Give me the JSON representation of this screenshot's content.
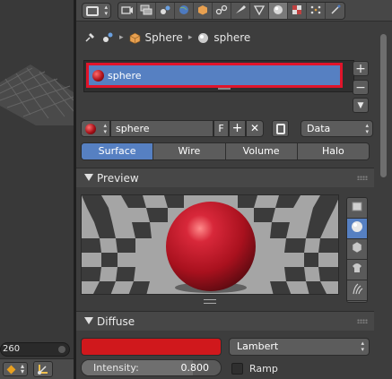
{
  "viewport": {
    "field_value": "260",
    "icons": {
      "keyframe": "keyframe-diamond-icon",
      "tool": "manipulator-icon"
    }
  },
  "header": {
    "editor_type_icon": "properties-editor-icon",
    "context_tabs": [
      {
        "name": "render-icon",
        "active": false
      },
      {
        "name": "render-layers-icon",
        "active": false
      },
      {
        "name": "scene-icon",
        "active": false
      },
      {
        "name": "world-icon",
        "active": false
      },
      {
        "name": "object-icon",
        "active": false
      },
      {
        "name": "constraints-icon",
        "active": false
      },
      {
        "name": "modifiers-icon",
        "active": false
      },
      {
        "name": "mesh-data-icon",
        "active": false
      },
      {
        "name": "material-icon",
        "active": true
      },
      {
        "name": "texture-icon",
        "active": false
      },
      {
        "name": "particles-icon",
        "active": false
      },
      {
        "name": "physics-icon",
        "active": false
      }
    ]
  },
  "breadcrumb": {
    "items": [
      "Sphere",
      "sphere"
    ],
    "icons": [
      "pin-icon",
      "scene-icon",
      "object-icon",
      "material-icon"
    ]
  },
  "slots": {
    "items": [
      {
        "label": "sphere",
        "selected": true
      }
    ],
    "buttons": {
      "add": "+",
      "remove": "−",
      "menu": "▼"
    }
  },
  "datablock": {
    "name": "sphere",
    "fake_user": "F",
    "new": "+",
    "unlink": "✕",
    "link": "Data"
  },
  "type_tabs": [
    {
      "label": "Surface",
      "active": true
    },
    {
      "label": "Wire",
      "active": false
    },
    {
      "label": "Volume",
      "active": false
    },
    {
      "label": "Halo",
      "active": false
    }
  ],
  "preview": {
    "title": "Preview",
    "types": [
      "flat-icon",
      "sphere-icon",
      "cube-icon",
      "monkey-icon",
      "hair-icon",
      "sphere-sky-icon"
    ],
    "active_type": 1
  },
  "diffuse": {
    "title": "Diffuse",
    "color": "#d0181c",
    "shader": "Lambert",
    "intensity_label": "Intensity:",
    "intensity_value": "0.800",
    "intensity_fraction": 0.8,
    "ramp_label": "Ramp"
  },
  "colors": {
    "accent": "#5680c2",
    "highlight_border": "#e0142a",
    "material": "#b8141c"
  }
}
